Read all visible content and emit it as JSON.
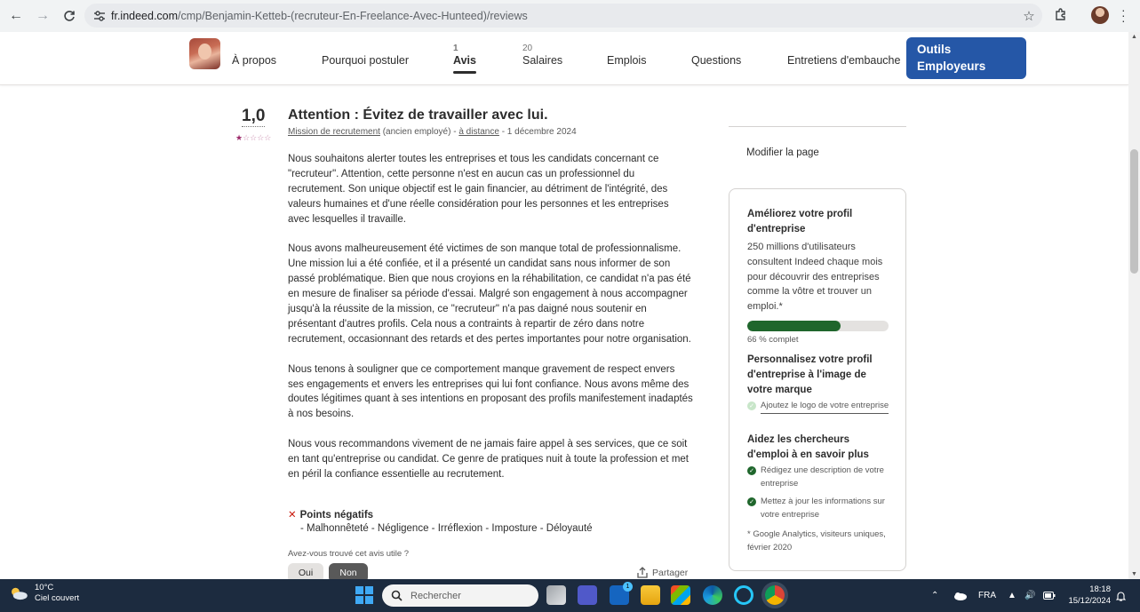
{
  "browser": {
    "url_host": "fr.indeed.com",
    "url_path": "/cmp/Benjamin-Ketteb-(recruteur-En-Freelance-Avec-Hunteed)/reviews"
  },
  "nav": {
    "items": [
      {
        "label": "À propos",
        "count": ""
      },
      {
        "label": "Pourquoi postuler",
        "count": ""
      },
      {
        "label": "Avis",
        "count": "1"
      },
      {
        "label": "Salaires",
        "count": "20"
      },
      {
        "label": "Emplois",
        "count": ""
      },
      {
        "label": "Questions",
        "count": ""
      },
      {
        "label": "Entretiens d'embauche",
        "count": ""
      }
    ],
    "employer_button": "Outils Employeurs"
  },
  "review": {
    "rating": "1,0",
    "stars": 1,
    "title": "Attention : Évitez de travailler avec lui.",
    "job": "Mission de recrutement",
    "status": "(ancien employé)",
    "sep1": " - ",
    "location": "à distance",
    "date": " - 1 décembre 2024",
    "paragraphs": [
      "Nous souhaitons alerter toutes les entreprises et tous les candidats concernant ce \"recruteur\". Attention, cette personne n'est en aucun cas un professionnel du recrutement. Son unique objectif est le gain financier, au détriment de l'intégrité, des valeurs humaines et d'une réelle considération pour les personnes et les entreprises avec lesquelles il travaille.",
      "Nous avons malheureusement été victimes de son manque total de professionnalisme. Une mission lui a été confiée, et il a présenté un candidat sans nous informer de son passé problématique. Bien que nous croyions en la réhabilitation, ce candidat n'a pas été en mesure de finaliser sa période d'essai. Malgré son engagement à nous accompagner jusqu'à la réussite de la mission, ce \"recruteur\" n'a pas daigné nous soutenir en présentant d'autres profils. Cela nous a contraints à repartir de zéro dans notre recrutement, occasionnant des retards et des pertes importantes pour notre organisation.",
      "Nous tenons à souligner que ce comportement manque gravement de respect envers ses engagements et envers les entreprises qui lui font confiance. Nous avons même des doutes légitimes quant à ses intentions en proposant des profils manifestement inadaptés à nos besoins.",
      "Nous vous recommandons vivement de ne jamais faire appel à ses services, que ce soit en tant qu'entreprise ou candidat. Ce genre de pratiques nuit à toute la profession et met en péril la confiance essentielle au recrutement."
    ],
    "negatives_label": "Points négatifs",
    "negatives_text": "- Malhonnêteté - Négligence - Irréflexion - Imposture - Déloyauté",
    "helpful_question": "Avez-vous trouvé cet avis utile ?",
    "yes": "Oui",
    "no": "Non",
    "share": "Partager"
  },
  "sidebar": {
    "modify": "Modifier la page",
    "card_title": "Améliorez votre profil d'entreprise",
    "card_text": "250 millions d'utilisateurs consultent Indeed chaque mois pour découvrir des entreprises comme la vôtre et trouver un emploi.*",
    "progress": 0.66,
    "progress_label": "66 % complet",
    "section1_title": "Personnalisez votre profil d'entreprise à l'image de votre marque",
    "section1_items": [
      "Ajoutez le logo de votre entreprise"
    ],
    "section2_title": "Aidez les chercheurs d'emploi à en savoir plus",
    "section2_items": [
      "Rédigez une description de votre entreprise",
      "Mettez à jour les informations sur votre entreprise"
    ],
    "footnote": "* Google Analytics, visiteurs uniques, février 2020"
  },
  "taskbar": {
    "temperature": "10°C",
    "weather": "Ciel couvert",
    "search": "Rechercher",
    "badge": "1",
    "language": "FRA",
    "time": "18:18",
    "date": "15/12/2024"
  }
}
